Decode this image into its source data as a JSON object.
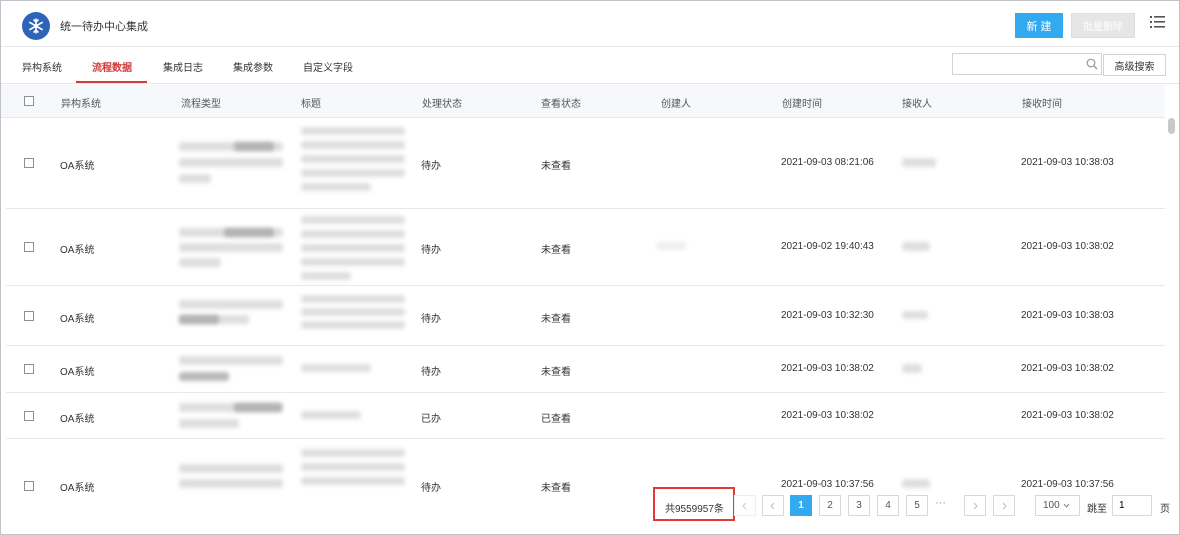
{
  "header": {
    "title": "统一待办中心集成",
    "new_label": "新 建",
    "batch_delete_label": "批量删除",
    "logo_icon": "snowflake-icon",
    "menu_icon": "list-menu-icon"
  },
  "tabs": [
    {
      "label": "异构系统",
      "active": false
    },
    {
      "label": "流程数据",
      "active": true
    },
    {
      "label": "集成日志",
      "active": false
    },
    {
      "label": "集成参数",
      "active": false
    },
    {
      "label": "自定义字段",
      "active": false
    }
  ],
  "search": {
    "placeholder": "",
    "advanced_label": "高级搜索"
  },
  "table": {
    "columns": [
      "异构系统",
      "流程类型",
      "标题",
      "处理状态",
      "查看状态",
      "创建人",
      "创建时间",
      "接收人",
      "接收时间"
    ],
    "rows": [
      {
        "system": "OA系统",
        "status": "待办",
        "view": "未查看",
        "created": "2021-09-03 08:21:06",
        "received": "2021-09-03 10:38:03"
      },
      {
        "system": "OA系统",
        "status": "待办",
        "view": "未查看",
        "created": "2021-09-02 19:40:43",
        "received": "2021-09-03 10:38:02"
      },
      {
        "system": "OA系统",
        "status": "待办",
        "view": "未查看",
        "created": "2021-09-03 10:32:30",
        "received": "2021-09-03 10:38:03"
      },
      {
        "system": "OA系统",
        "status": "待办",
        "view": "未查看",
        "created": "2021-09-03 10:38:02",
        "received": "2021-09-03 10:38:02"
      },
      {
        "system": "OA系统",
        "status": "已办",
        "view": "已查看",
        "created": "2021-09-03 10:38:02",
        "received": "2021-09-03 10:38:02"
      },
      {
        "system": "OA系统",
        "status": "待办",
        "view": "未查看",
        "created": "2021-09-03 10:37:56",
        "received": "2021-09-03 10:37:56"
      }
    ]
  },
  "pagination": {
    "total_text": "共9559957条",
    "pages": [
      "1",
      "2",
      "3",
      "4",
      "5"
    ],
    "current": "1",
    "ellipsis": "···",
    "page_size": "100",
    "goto_label": "跳至",
    "goto_value": "1",
    "page_suffix": "页"
  },
  "colors": {
    "accent": "#33a9ef",
    "active_tab": "#d13b3b",
    "highlight_box": "#e53935"
  }
}
